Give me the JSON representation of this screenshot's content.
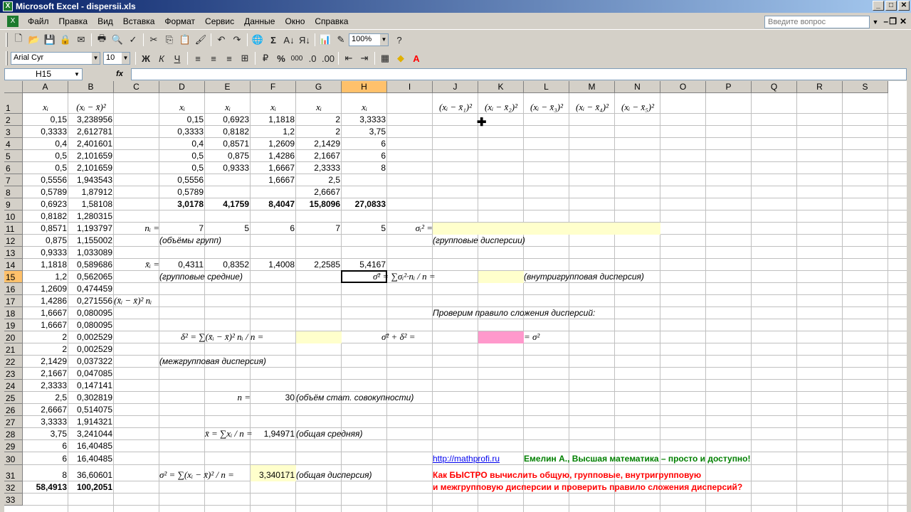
{
  "window": {
    "title": "Microsoft Excel - dispersii.xls",
    "min": "_",
    "max": "□",
    "close": "✕"
  },
  "menu": [
    "Файл",
    "Правка",
    "Вид",
    "Вставка",
    "Формат",
    "Сервис",
    "Данные",
    "Окно",
    "Справка"
  ],
  "ask": {
    "placeholder": "Введите вопрос"
  },
  "toolbar": {
    "zoom": "100%",
    "font": "Arial Cyr",
    "size": "10",
    "bold": "Ж",
    "italic": "К",
    "underline": "Ч",
    "sigma": "Σ",
    "percent": "%",
    "thousands": "000"
  },
  "formula": {
    "namebox": "H15",
    "fx": "fx"
  },
  "columns": [
    "A",
    "B",
    "C",
    "D",
    "E",
    "F",
    "G",
    "H",
    "I",
    "J",
    "K",
    "L",
    "M",
    "N",
    "O",
    "P",
    "Q",
    "R",
    "S"
  ],
  "rows": [
    "1",
    "2",
    "3",
    "4",
    "5",
    "6",
    "7",
    "8",
    "9",
    "10",
    "11",
    "12",
    "13",
    "14",
    "15",
    "16",
    "17",
    "18",
    "19",
    "20",
    "21",
    "22",
    "23",
    "24",
    "25",
    "26",
    "27",
    "28",
    "29",
    "30",
    "31",
    "32",
    "33"
  ],
  "colA": [
    "0,15",
    "0,3333",
    "0,4",
    "0,5",
    "0,5",
    "0,5556",
    "0,5789",
    "0,6923",
    "0,8182",
    "0,8571",
    "0,875",
    "0,9333",
    "1,1818",
    "1,2",
    "1,2609",
    "1,4286",
    "1,6667",
    "1,6667",
    "2",
    "2",
    "2,1429",
    "2,1667",
    "2,3333",
    "2,5",
    "2,6667",
    "3,3333",
    "3,75",
    "6",
    "6",
    "8",
    "58,4913"
  ],
  "colB": [
    "3,238956",
    "2,612781",
    "2,401601",
    "2,101659",
    "2,101659",
    "1,943543",
    "1,87912",
    "1,58108",
    "1,280315",
    "1,193797",
    "1,155002",
    "1,033089",
    "0,589686",
    "0,562065",
    "0,474459",
    "0,271556",
    "0,080095",
    "0,080095",
    "0,002529",
    "0,002529",
    "0,037322",
    "0,047085",
    "0,147141",
    "0,302819",
    "0,514075",
    "1,914321",
    "3,241044",
    "16,40485",
    "16,40485",
    "36,60601",
    "100,2051"
  ],
  "groups": {
    "D": [
      "0,15",
      "0,3333",
      "0,4",
      "0,5",
      "0,5",
      "0,5556",
      "0,5789",
      "3,0178"
    ],
    "E": [
      "0,6923",
      "0,8182",
      "0,8571",
      "0,875",
      "0,9333",
      "",
      "",
      "4,1759"
    ],
    "F": [
      "1,1818",
      "1,2",
      "1,2609",
      "1,4286",
      "1,6667",
      "1,6667",
      "",
      "8,4047"
    ],
    "G": [
      "2",
      "2",
      "2,1429",
      "2,1667",
      "2,3333",
      "2,5",
      "2,6667",
      "15,8096"
    ],
    "H": [
      "3,3333",
      "3,75",
      "6",
      "6",
      "8",
      "",
      "",
      "27,0833"
    ]
  },
  "ni": {
    "label": "nᵢ =",
    "values": [
      "7",
      "5",
      "6",
      "7",
      "5"
    ],
    "caption": "(объёмы групп)"
  },
  "means": {
    "label": "x̄ᵢ =",
    "values": [
      "0,4311",
      "0,8352",
      "1,4008",
      "2,2585",
      "5,4167"
    ],
    "caption": "(групповые средние)"
  },
  "headers": {
    "xi": "xᵢ",
    "dev": "(xᵢ − x̄)²",
    "devgroup": [
      "(xᵢ − x̄₁)²",
      "(xᵢ − x̄₂)²",
      "(xᵢ − x̄₃)²",
      "(xᵢ − x̄₄)²",
      "(xᵢ − x̄₅)²"
    ],
    "c17": "(x̄ᵢ − x̄)² nᵢ"
  },
  "labels": {
    "sigma_i": "σᵢ² =",
    "group_disp": "(групповые дисперсии)",
    "within_formula": "σ̄² = ∑σᵢ²·nᵢ / n =",
    "within_caption": "(внутригрупповая дисперсия)",
    "check": "Проверим правило сложения дисперсий:",
    "check_formula": "σ̄² + δ² =",
    "check_eq": "= σ²",
    "delta_formula": "δ² = ∑(x̄ᵢ − x̄)² nᵢ / n =",
    "between_caption": "(межгрупповая дисперсия)",
    "n_label": "n =",
    "n_value": "30",
    "n_caption": "(объём стат. совокупности)",
    "mean_formula": "x̄ = ∑xᵢ / n =",
    "mean_value": "1,94971",
    "mean_caption": "(общая средняя)",
    "var_formula": "σ² = ∑(xᵢ − x̄)² / n =",
    "var_value": "3,340171",
    "var_caption": "(общая дисперсия)"
  },
  "footer": {
    "link": "http://mathprofi.ru",
    "author": "Емелин А., Высшая математика – просто и доступно!",
    "line1": "Как БЫСТРО вычислить общую, групповые, внутригрупповую",
    "line2": " и межгрупповую дисперсии и проверить правило сложения дисперсий?"
  }
}
